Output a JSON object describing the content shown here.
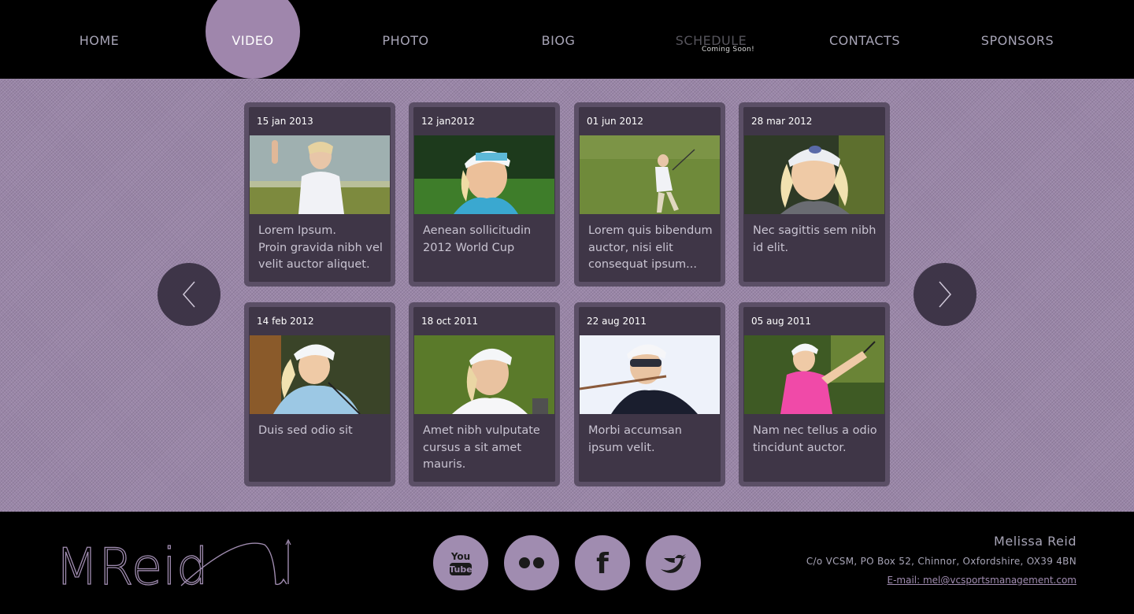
{
  "nav": {
    "items": [
      {
        "label": "HOME"
      },
      {
        "label": "VIDEO"
      },
      {
        "label": "PHOTO"
      },
      {
        "label": "BIOG"
      },
      {
        "label": "SCHEDULE",
        "sub": "Coming Soon!"
      },
      {
        "label": "CONTACTS"
      },
      {
        "label": "SPONSORS"
      }
    ],
    "active": "VIDEO"
  },
  "cards": [
    {
      "date": "15 jan 2013",
      "text": "Lorem Ipsum.\nProin gravida nibh vel velit auctor aliquet."
    },
    {
      "date": "12 jan2012",
      "text": "Aenean sollicitudin 2012 World Cup"
    },
    {
      "date": "01 jun 2012",
      "text": "Lorem quis bibendum auctor, nisi elit consequat ipsum..."
    },
    {
      "date": "28 mar 2012",
      "text": "Nec sagittis sem nibh id elit."
    },
    {
      "date": "14 feb 2012",
      "text": "Duis sed odio sit"
    },
    {
      "date": "18 oct 2011",
      "text": "Amet nibh vulputate cursus a sit amet mauris."
    },
    {
      "date": "22 aug 2011",
      "text": "Morbi accumsan ipsum velit."
    },
    {
      "date": "05 aug 2011",
      "text": "Nam nec tellus a odio tincidunt auctor."
    }
  ],
  "arrows": {
    "prev_icon": "chevron-left-icon",
    "next_icon": "chevron-right-icon"
  },
  "footer": {
    "logo_text": "MReid",
    "social": [
      {
        "name": "youtube-icon",
        "line1": "You",
        "line2": "Tube"
      },
      {
        "name": "flickr-icon"
      },
      {
        "name": "facebook-icon",
        "glyph": "f"
      },
      {
        "name": "twitter-icon"
      }
    ],
    "contact": {
      "name": "Melissa Reid",
      "address": "C/o VCSM, PO Box 52, Chinnor, Oxfordshire, OX39 4BN",
      "email": "E-mail: mel@vcsportsmanagement.com"
    }
  },
  "colors": {
    "accent": "#9f86ac",
    "card": "#3f3647",
    "background": "#9a86a8"
  }
}
